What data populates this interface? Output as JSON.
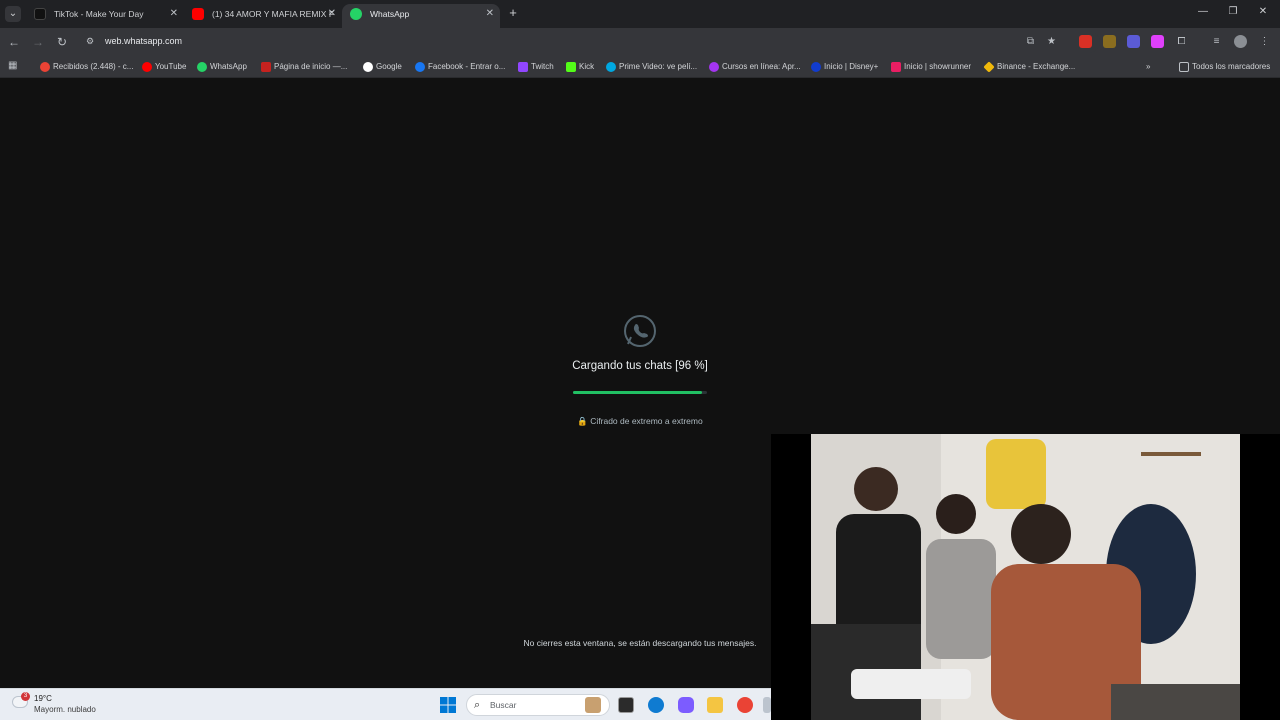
{
  "browser": {
    "tabs": [
      {
        "title": "TikTok - Make Your Day",
        "icon": "tiktok-icon",
        "active": false
      },
      {
        "title": "(1) 34 AMOR Y MAFIA REMIX F",
        "icon": "youtube-icon",
        "active": false
      },
      {
        "title": "WhatsApp",
        "icon": "whatsapp-icon",
        "active": true
      }
    ],
    "url": "web.whatsapp.com",
    "bookmarks": [
      {
        "label": "Recibidos (2.448) - c...",
        "icon": "gmail-icon"
      },
      {
        "label": "YouTube",
        "icon": "youtube-icon"
      },
      {
        "label": "WhatsApp",
        "icon": "whatsapp-icon"
      },
      {
        "label": "Página de inicio —...",
        "icon": "page-icon"
      },
      {
        "label": "Google",
        "icon": "google-icon"
      },
      {
        "label": "Facebook - Entrar o...",
        "icon": "facebook-icon"
      },
      {
        "label": "Twitch",
        "icon": "twitch-icon"
      },
      {
        "label": "Kick",
        "icon": "kick-icon"
      },
      {
        "label": "Prime Video: ve pelí...",
        "icon": "prime-video-icon"
      },
      {
        "label": "Cursos en línea: Apr...",
        "icon": "courses-icon"
      },
      {
        "label": "Inicio | Disney+",
        "icon": "disney-icon"
      },
      {
        "label": "Inicio | showrunner",
        "icon": "showrunner-icon"
      },
      {
        "label": "Binance - Exchange...",
        "icon": "binance-icon"
      }
    ],
    "all_bookmarks_label": "Todos los marcadores"
  },
  "whatsapp": {
    "loading_title": "Cargando tus chats [96 %]",
    "progress": 0.96,
    "encryption_note": "Cifrado de extremo a extremo",
    "bottom_note": "No cierres esta ventana, se están descargando tus mensajes."
  },
  "taskbar": {
    "weather_badge": "3",
    "weather_temp": "19°C",
    "weather_desc": "Mayorm. nublado",
    "search_placeholder": "Buscar"
  },
  "colors": {
    "accent_green": "#21c063",
    "background": "#111111"
  }
}
